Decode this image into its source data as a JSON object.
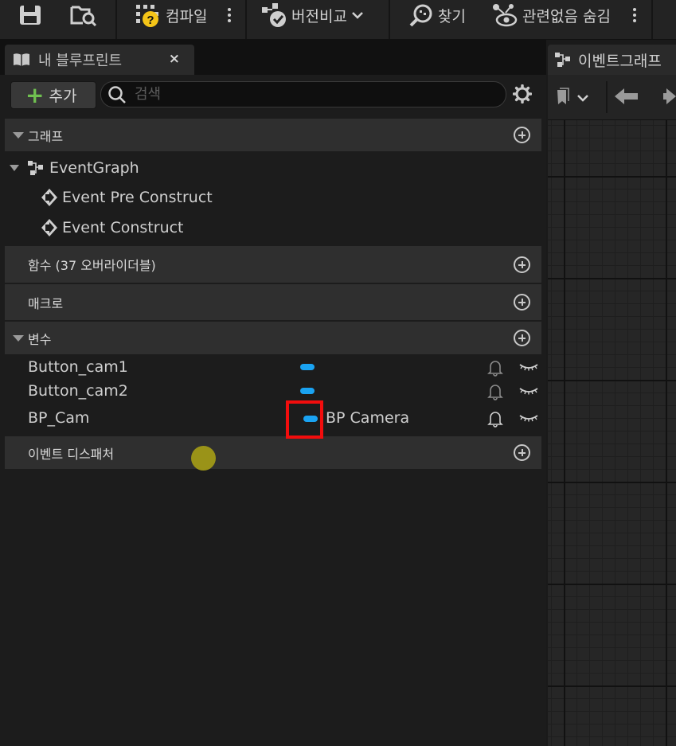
{
  "toolbar": {
    "compile_label": "컴파일",
    "diff_label": "버전비교",
    "find_label": "찾기",
    "hide_unrelated_label": "관련없음 숨김",
    "icons": [
      "save-icon",
      "browse-icon",
      "compile-icon",
      "options-icon",
      "diff-icon",
      "find-icon",
      "hide-unrelated-icon"
    ]
  },
  "my_blueprint": {
    "tab_title": "내 블루프린트",
    "close_glyph": "×",
    "add_label": "추가",
    "search_placeholder": "검색"
  },
  "sections": {
    "graphs": {
      "label": "그래프"
    },
    "functions": {
      "label": "함수 (37 오버라이더블)"
    },
    "macros": {
      "label": "매크로"
    },
    "variables": {
      "label": "변수"
    },
    "dispatchers": {
      "label": "이벤트 디스패처"
    }
  },
  "event_graph": {
    "label": "EventGraph",
    "events": [
      "Event Pre Construct",
      "Event Construct"
    ]
  },
  "variables": [
    {
      "name": "Button_cam1",
      "type": "",
      "color": "#1aa3f2"
    },
    {
      "name": "Button_cam2",
      "type": "",
      "color": "#1aa3f2"
    },
    {
      "name": "BP_Cam",
      "type": "BP Camera",
      "color": "#1aa3f2"
    }
  ],
  "graph_tab": {
    "title": "이벤트그래프"
  },
  "colors": {
    "accent_green": "#70c050",
    "variable_pill": "#1aa3f2",
    "highlight_red": "#f20d0d"
  }
}
